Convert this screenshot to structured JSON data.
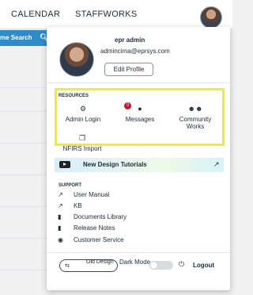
{
  "topbar": {
    "calendar": "CALENDAR",
    "staffworks": "STAFFWORKS",
    "avatar_icon": "user-avatar"
  },
  "search": {
    "label": "me Search",
    "icon": "search-icon"
  },
  "profile": {
    "name": "epr admin",
    "email": "admincima@eprsys.com",
    "edit_label": "Edit Profile"
  },
  "resources": {
    "title": "RESOURCES",
    "items": [
      {
        "label": "Admin Login",
        "icon": "gear-icon"
      },
      {
        "label": "Messages",
        "icon": "chat-icon",
        "badge": "0"
      },
      {
        "label": "Community Works",
        "icon": "people-icon"
      },
      {
        "label": "NFIRS Import",
        "icon": "copy-icon"
      }
    ],
    "highlight_color": "#f4ee1e"
  },
  "tutorials": {
    "label": "New Design Tutorials",
    "icon": "video-icon"
  },
  "support": {
    "title": "SUPPORT",
    "items": [
      {
        "label": "User Manual",
        "icon": "external-link-icon"
      },
      {
        "label": "KB",
        "icon": "external-link-icon"
      },
      {
        "label": "Documents Library",
        "icon": "document-icon"
      },
      {
        "label": "Release Notes",
        "icon": "document-icon"
      },
      {
        "label": "Customer Service",
        "icon": "eye-icon"
      }
    ]
  },
  "bottom": {
    "old_design_label": "Old Design",
    "dark_mode_label": "Dark Mode",
    "logout_label": "Logout",
    "dark_mode_on": false
  },
  "colors": {
    "search_strip": "#2f8cc9",
    "badge": "#c8102e"
  }
}
